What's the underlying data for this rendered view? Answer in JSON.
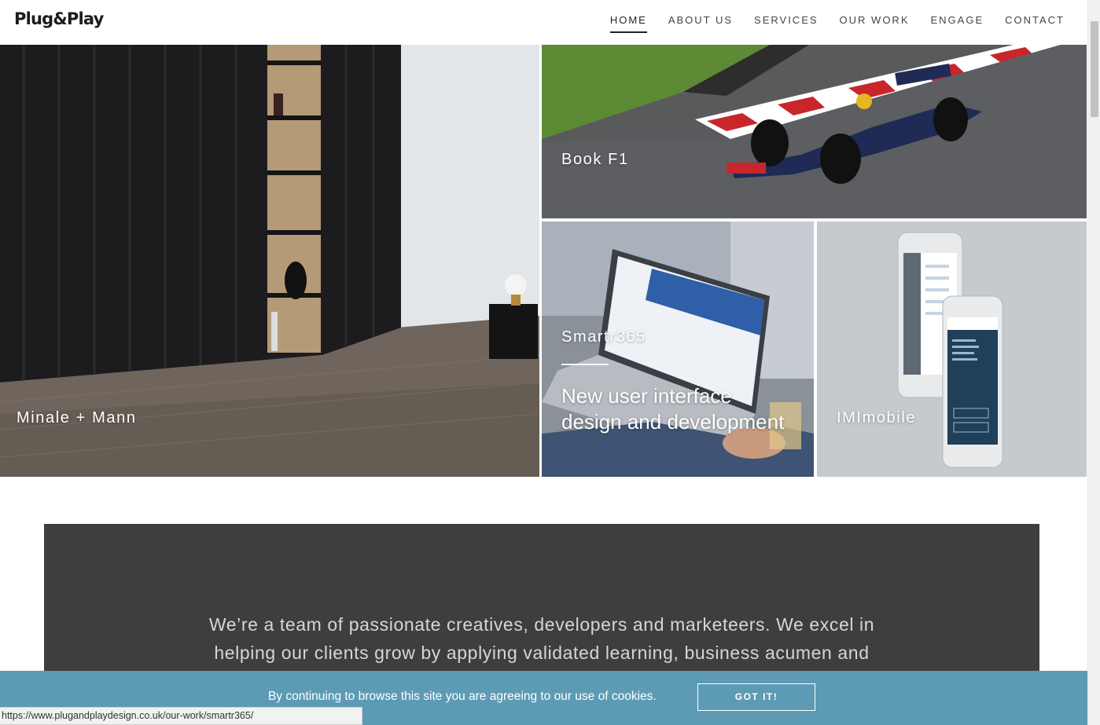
{
  "header": {
    "logo": "Plug&Play",
    "nav": [
      {
        "label": "HOME",
        "active": true
      },
      {
        "label": "ABOUT US",
        "active": false
      },
      {
        "label": "SERVICES",
        "active": false
      },
      {
        "label": "OUR WORK",
        "active": false
      },
      {
        "label": "ENGAGE",
        "active": false
      },
      {
        "label": "CONTACT",
        "active": false
      }
    ]
  },
  "tiles": {
    "minale": {
      "title": "Minale + Mann"
    },
    "bookf1": {
      "title": "Book F1"
    },
    "smartr": {
      "title": "Smartr365",
      "subtitle_line1": "New user interface",
      "subtitle_line2": "design and development"
    },
    "imi": {
      "title": "IMImobile"
    }
  },
  "intro": {
    "line1": "We’re a team of passionate creatives, developers and marketeers. We excel in",
    "line2": "helping our clients grow by applying validated learning, business acumen and"
  },
  "cookie": {
    "message": "By continuing to browse this site you are agreeing to our use of cookies.",
    "button": "GOT IT!"
  },
  "status": {
    "url": "https://www.plugandplaydesign.co.uk/our-work/smartr365/"
  },
  "colors": {
    "cookie_bg": "#5c9bb3",
    "intro_bg": "#3e3e3e"
  }
}
